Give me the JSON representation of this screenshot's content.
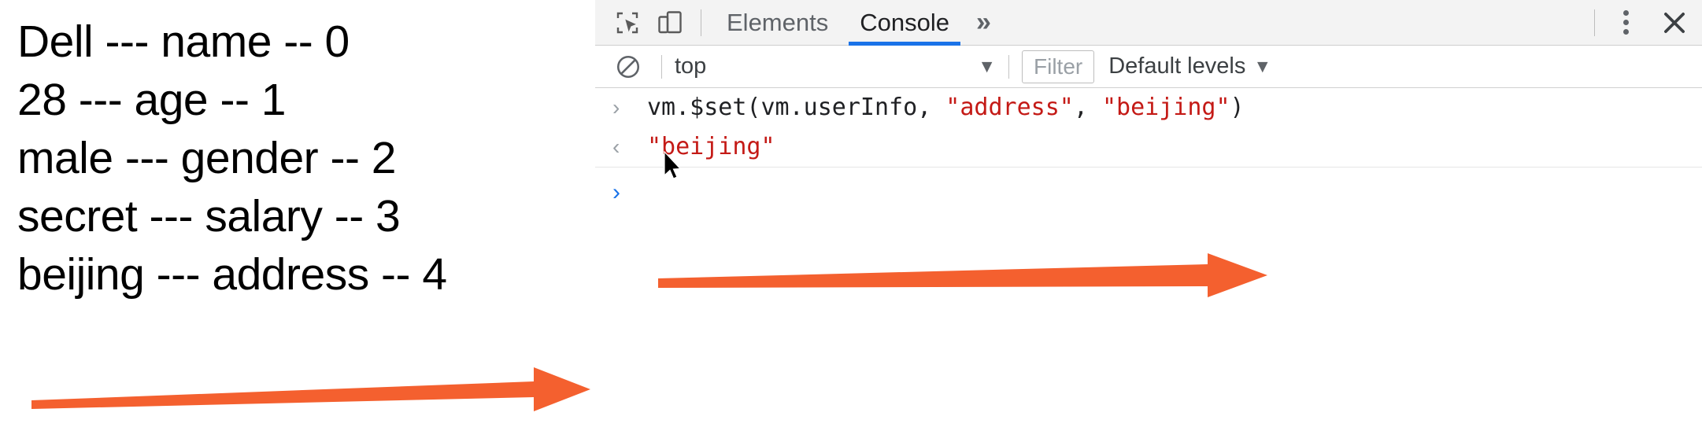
{
  "page_output": {
    "lines": [
      "Dell --- name -- 0",
      "28 --- age -- 1",
      "male --- gender -- 2",
      "secret --- salary -- 3",
      "beijing --- address -- 4"
    ],
    "annotation_arrow_color": "#f4602f"
  },
  "devtools": {
    "toolbar": {
      "inspect_icon": "inspect-element-icon",
      "device_toggle_icon": "device-toolbar-icon",
      "tabs": [
        {
          "label": "Elements",
          "active": false
        },
        {
          "label": "Console",
          "active": true
        }
      ],
      "more_tabs_label": "»",
      "menu_icon": "kebab-menu-icon",
      "close_icon": "close-icon",
      "active_tab_underline_color": "#1a73e8"
    },
    "filterbar": {
      "clear_console_icon": "clear-console-icon",
      "context_value": "top",
      "context_caret": "▼",
      "filter_placeholder": "Filter",
      "levels_label": "Default levels",
      "levels_caret": "▼"
    },
    "console": {
      "messages": [
        {
          "type": "input",
          "gutter": "›",
          "parts": [
            {
              "t": "vm.$set(vm.userInfo, ",
              "cls": "code"
            },
            {
              "t": "\"address\"",
              "cls": "str"
            },
            {
              "t": ", ",
              "cls": "code"
            },
            {
              "t": "\"beijing\"",
              "cls": "str"
            },
            {
              "t": ")",
              "cls": "code"
            }
          ]
        },
        {
          "type": "result",
          "gutter": "‹",
          "parts": [
            {
              "t": "\"beijing\"",
              "cls": "result-text"
            }
          ]
        },
        {
          "type": "prompt",
          "gutter": "›",
          "parts": []
        }
      ],
      "annotation_arrow_color": "#f4602f",
      "cursor_icon": "mouse-pointer-icon"
    }
  }
}
